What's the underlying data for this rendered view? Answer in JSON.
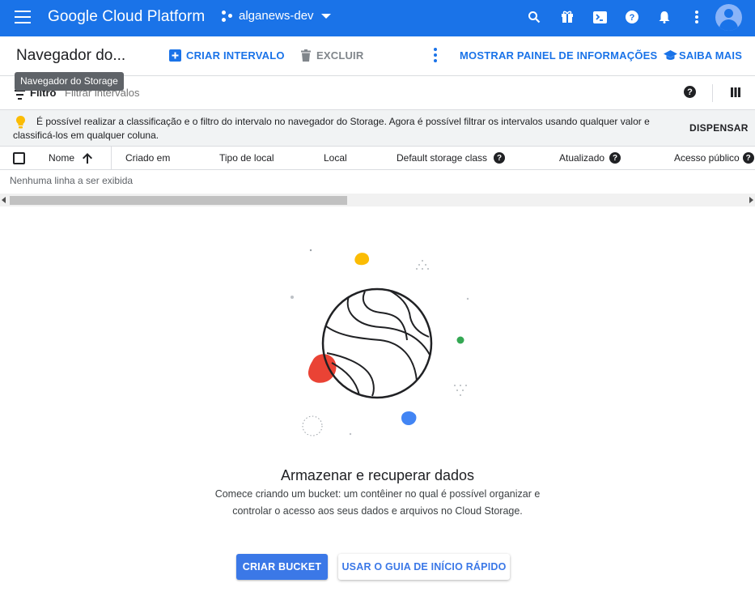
{
  "topbar": {
    "brand": "Google Cloud Platform",
    "project": "alganews-dev",
    "icons": [
      "menu-icon",
      "search-icon",
      "gift-icon",
      "cloud-shell-icon",
      "help-icon",
      "notifications-icon",
      "more-vert-icon",
      "account-avatar"
    ]
  },
  "actionbar": {
    "title": "Navegador do...",
    "tooltip": "Navegador do Storage",
    "create": "CRIAR INTERVALO",
    "delete": "EXCLUIR",
    "info_panel": "MOSTRAR PAINEL DE INFORMAÇÕES",
    "learn_more": "SAIBA MAIS"
  },
  "filter": {
    "label": "Filtro",
    "placeholder": "Filtrar intervalos"
  },
  "banner": {
    "text": "É possível realizar a classificação e o filtro do intervalo no navegador do Storage. Agora é possível filtrar os intervalos usando qualquer valor e classificá-los em qualquer coluna.",
    "dismiss": "DISPENSAR"
  },
  "table": {
    "columns": {
      "name": "Nome",
      "created": "Criado em",
      "location_type": "Tipo de local",
      "location": "Local",
      "storage_class": "Default storage class",
      "updated": "Atualizado",
      "public_access": "Acesso público"
    },
    "empty": "Nenhuma linha a ser exibida"
  },
  "empty_state": {
    "title": "Armazenar e recuperar dados",
    "description": "Comece criando um bucket: um contêiner no qual é possível organizar e controlar o acesso aos seus dados e arquivos no Cloud Storage.",
    "primary_button": "CRIAR BUCKET",
    "secondary_button": "USAR O GUIA DE INÍCIO RÁPIDO"
  },
  "colors": {
    "header_blue": "#1a73e8",
    "button_blue": "#3b78e7",
    "banner_bg": "#f1f3f4",
    "accent_yellow": "#fbbc04",
    "accent_red": "#ea4335",
    "accent_green": "#34a853"
  }
}
